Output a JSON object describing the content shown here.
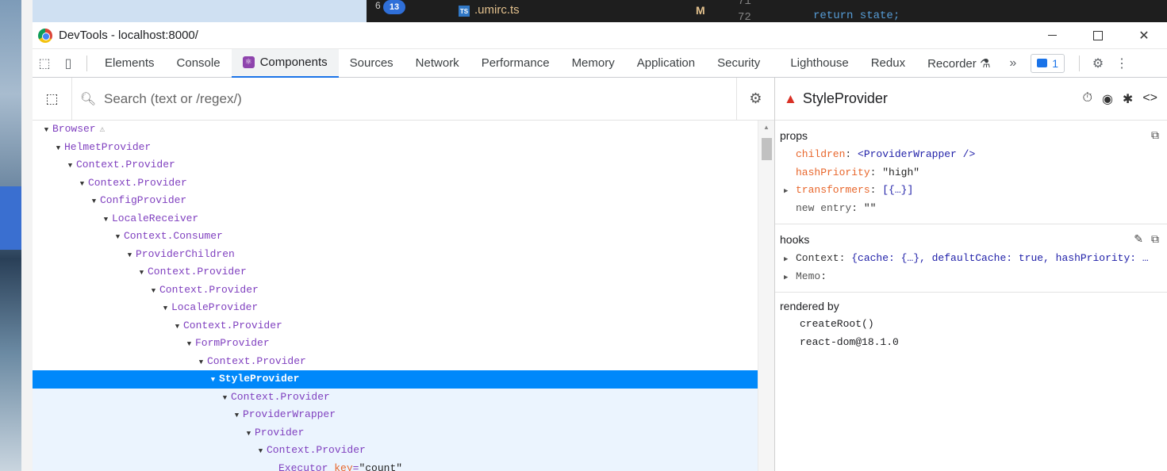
{
  "background": {
    "editor_badge_count": "13",
    "editor_badge_prefix": "6",
    "editor_file_icon": "TS",
    "editor_file_name": ".umirc.ts",
    "editor_file_status": "M",
    "editor_line_numbers": [
      "71",
      "72"
    ],
    "editor_code": "return state;"
  },
  "window": {
    "title": "DevTools - localhost:8000/"
  },
  "tabs": [
    {
      "label": "Elements"
    },
    {
      "label": "Console"
    },
    {
      "label": "Components"
    },
    {
      "label": "Sources"
    },
    {
      "label": "Network"
    },
    {
      "label": "Performance"
    },
    {
      "label": "Memory"
    },
    {
      "label": "Application"
    },
    {
      "label": "Security"
    },
    {
      "label": "Lighthouse"
    },
    {
      "label": "Redux"
    },
    {
      "label": "Recorder ⚗"
    }
  ],
  "active_tab": "Components",
  "issues_count": "1",
  "search": {
    "placeholder": "Search (text or /regex/)"
  },
  "tree": [
    {
      "name": "Browser"
    },
    {
      "name": "HelmetProvider"
    },
    {
      "name": "Context.Provider"
    },
    {
      "name": "Context.Provider"
    },
    {
      "name": "ConfigProvider"
    },
    {
      "name": "LocaleReceiver"
    },
    {
      "name": "Context.Consumer"
    },
    {
      "name": "ProviderChildren"
    },
    {
      "name": "Context.Provider"
    },
    {
      "name": "Context.Provider"
    },
    {
      "name": "LocaleProvider"
    },
    {
      "name": "Context.Provider"
    },
    {
      "name": "FormProvider"
    },
    {
      "name": "Context.Provider"
    },
    {
      "name": "StyleProvider"
    },
    {
      "name": "Context.Provider"
    },
    {
      "name": "ProviderWrapper"
    },
    {
      "name": "Provider"
    },
    {
      "name": "Context.Provider"
    },
    {
      "name": "Executor",
      "key_attr": "key",
      "key_val": "\"count\""
    }
  ],
  "selected_component": "StyleProvider",
  "props": {
    "title": "props",
    "items": [
      {
        "name": "children",
        "value": "<ProviderWrapper />"
      },
      {
        "name": "hashPriority",
        "value": "\"high\""
      },
      {
        "name": "transformers",
        "value": "[{…}]"
      },
      {
        "name": "new entry",
        "value": "\"\""
      }
    ]
  },
  "hooks": {
    "title": "hooks",
    "items": [
      {
        "name": "Context",
        "value": "{cache: {…}, defaultCache: true, hashPriority: …"
      },
      {
        "name": "Memo",
        "value": ""
      }
    ]
  },
  "rendered_by": {
    "title": "rendered by",
    "items": [
      "createRoot()",
      "react-dom@18.1.0"
    ]
  }
}
